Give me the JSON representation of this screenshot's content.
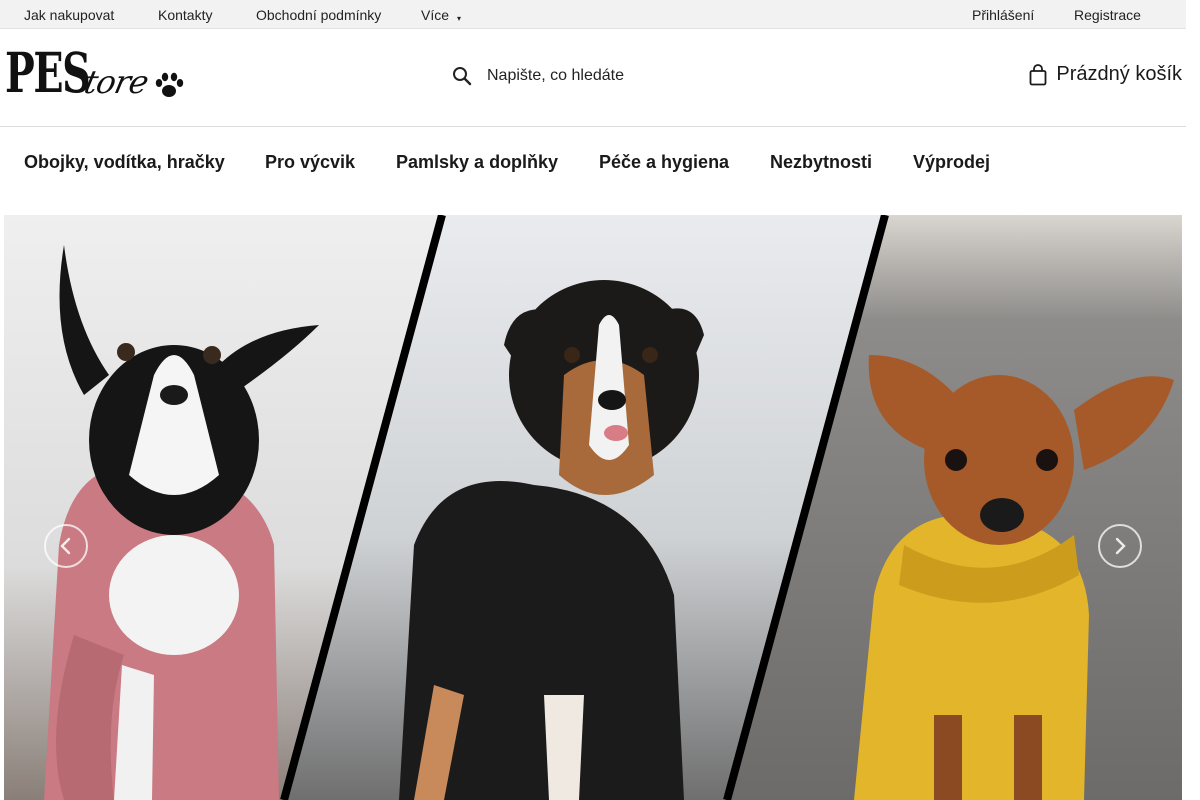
{
  "topbar": {
    "links": [
      "Jak nakupovat",
      "Kontakty",
      "Obchodní podmínky",
      "Více"
    ],
    "more_caret": "▾",
    "login": "Přihlášení",
    "register": "Registrace"
  },
  "header": {
    "logo_main": "PES",
    "logo_script": "tore",
    "search_placeholder": "Napište, co hledáte",
    "cart_label": "Prázdný košík"
  },
  "nav": {
    "items": [
      "Obojky, vodítka, hračky",
      "Pro výcvik",
      "Pamlsky a doplňky",
      "Péče a hygiena",
      "Nezbytnosti",
      "Výprodej"
    ]
  },
  "carousel": {
    "prev_icon": "chevron-left-icon",
    "next_icon": "chevron-right-icon",
    "slide": {
      "panels": [
        {
          "dog": "border collie",
          "coat_color": "#c97a82"
        },
        {
          "dog": "australian shepherd",
          "coat_color": "#1b1b1b"
        },
        {
          "dog": "miniature pinscher",
          "coat_color": "#e3b52a"
        }
      ]
    }
  },
  "colors": {
    "topbar_bg": "#f2f2f2",
    "text": "#1a1a1a"
  }
}
